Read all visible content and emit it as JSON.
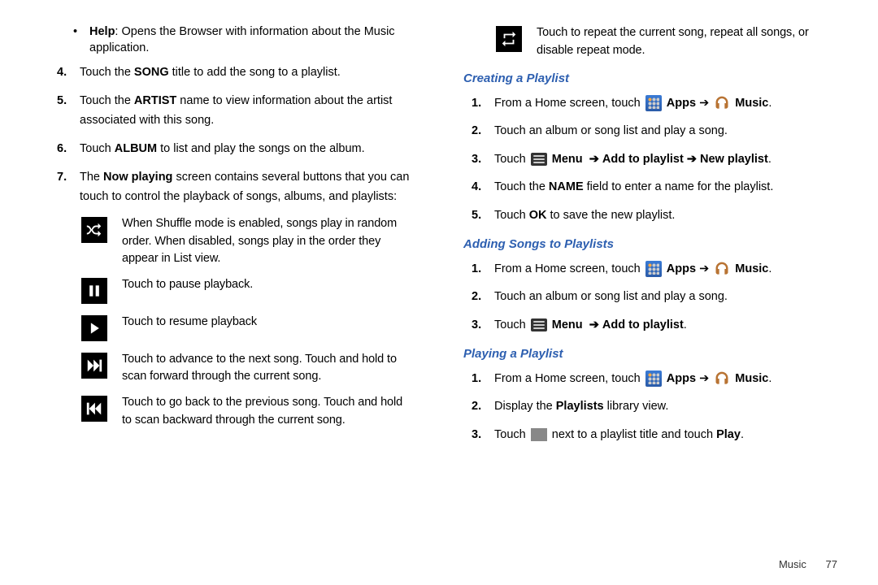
{
  "left": {
    "bullet": {
      "label": "Help",
      "text": ": Opens the Browser with information about the Music application."
    },
    "s4": {
      "pre": "Touch the ",
      "b": "SONG",
      "post": " title to add the song to a playlist."
    },
    "s5": {
      "pre": "Touch the ",
      "b": "ARTIST",
      "post": " name to view information about the artist associated with this song."
    },
    "s6": {
      "pre": "Touch ",
      "b": "ALBUM",
      "post": " to list and play the songs on the album."
    },
    "s7": {
      "pre": "The ",
      "b": "Now playing",
      "post": " screen contains several buttons that you can touch to control the playback of songs, albums, and playlists:"
    },
    "icons": {
      "shuffle": "When Shuffle mode is enabled, songs play in random order. When disabled, songs play in the order they appear in List view.",
      "pause": "Touch to pause playback.",
      "play": "Touch to resume playback",
      "next": "Touch to advance to the next song. Touch and hold to scan forward through the current song.",
      "prev": "Touch to go back to the previous song. Touch and hold to scan backward through the current song."
    }
  },
  "right": {
    "repeat": "Touch to repeat the current song, repeat all songs, or disable repeat mode.",
    "secA": {
      "title": "Creating a Playlist",
      "s1_pre": "From a Home screen, touch ",
      "apps": "Apps",
      "arrow": "➔",
      "music": "Music",
      "s2": "Touch an album or song list and play a song.",
      "s3_touch": "Touch ",
      "s3_menu": "Menu",
      "s3_arr1": "➔",
      "s3_addpl": "Add to playlist",
      "s3_arr2": "➔",
      "s3_newpl": "New playlist",
      "s4_pre": "Touch the ",
      "s4_b": "NAME",
      "s4_post": " field to enter a name for the playlist.",
      "s5_pre": "Touch ",
      "s5_b": "OK",
      "s5_post": " to save the new playlist."
    },
    "secB": {
      "title": "Adding Songs to Playlists",
      "s2": "Touch an album or song list and play a song.",
      "s3_touch": "Touch ",
      "s3_menu": "Menu",
      "s3_arr": "➔",
      "s3_addpl": "Add to playlist"
    },
    "secC": {
      "title": "Playing a Playlist",
      "s2_pre": "Display the ",
      "s2_b": "Playlists",
      "s2_post": " library view.",
      "s3_pre": "Touch ",
      "s3_post": " next to a playlist title and touch ",
      "s3_b": "Play"
    }
  },
  "footer": {
    "section": "Music",
    "page": "77"
  },
  "labels": {
    "n4": "4.",
    "n5": "5.",
    "n6": "6.",
    "n7": "7.",
    "n1": "1.",
    "n2": "2.",
    "n3": "3."
  }
}
